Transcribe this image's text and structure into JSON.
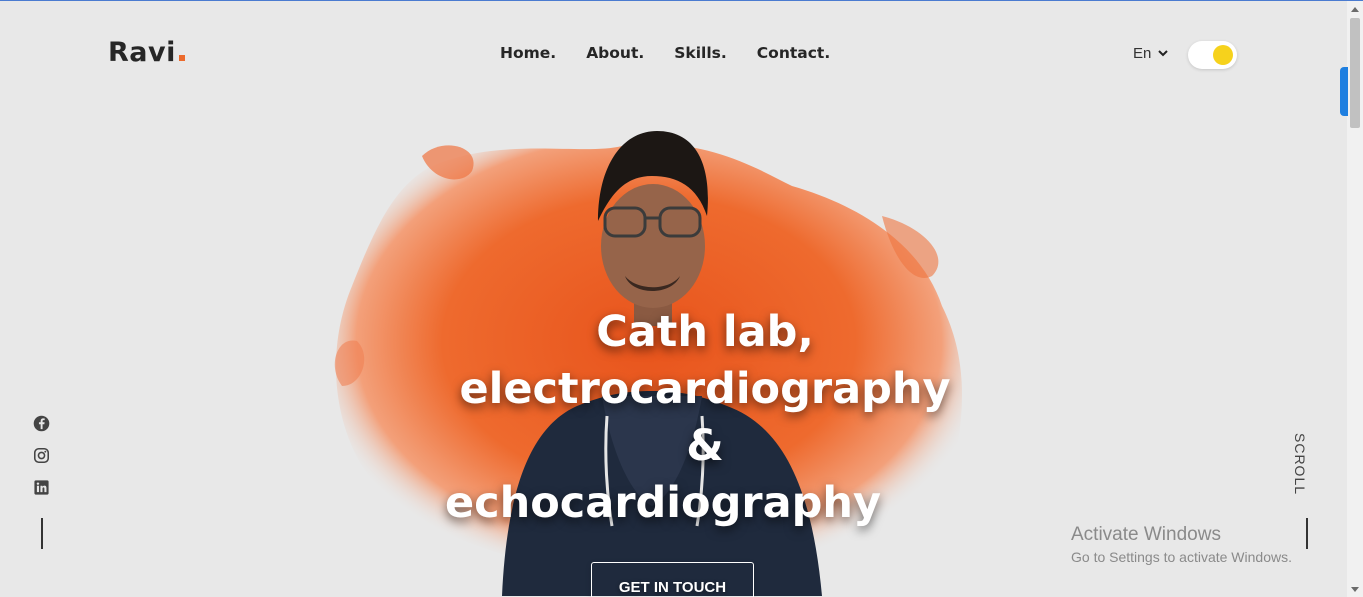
{
  "header": {
    "logo": "Ravi",
    "nav": [
      "Home.",
      "About.",
      "Skills.",
      "Contact."
    ],
    "language": "En",
    "theme_toggle_on": true
  },
  "hero": {
    "lines": [
      "Cath lab,",
      "electrocardiography",
      "&",
      "echocardiography"
    ],
    "cta_label": "GET IN TOUCH"
  },
  "social": [
    "facebook-icon",
    "instagram-icon",
    "linkedin-icon"
  ],
  "scroll_label": "SCROLL",
  "watermark": {
    "title": "Activate Windows",
    "subtitle": "Go to Settings to activate Windows."
  },
  "colors": {
    "background": "#e8e8e8",
    "accent": "#ec6a2c",
    "toggle_knob": "#f6d21c",
    "text_dark": "#262626"
  }
}
